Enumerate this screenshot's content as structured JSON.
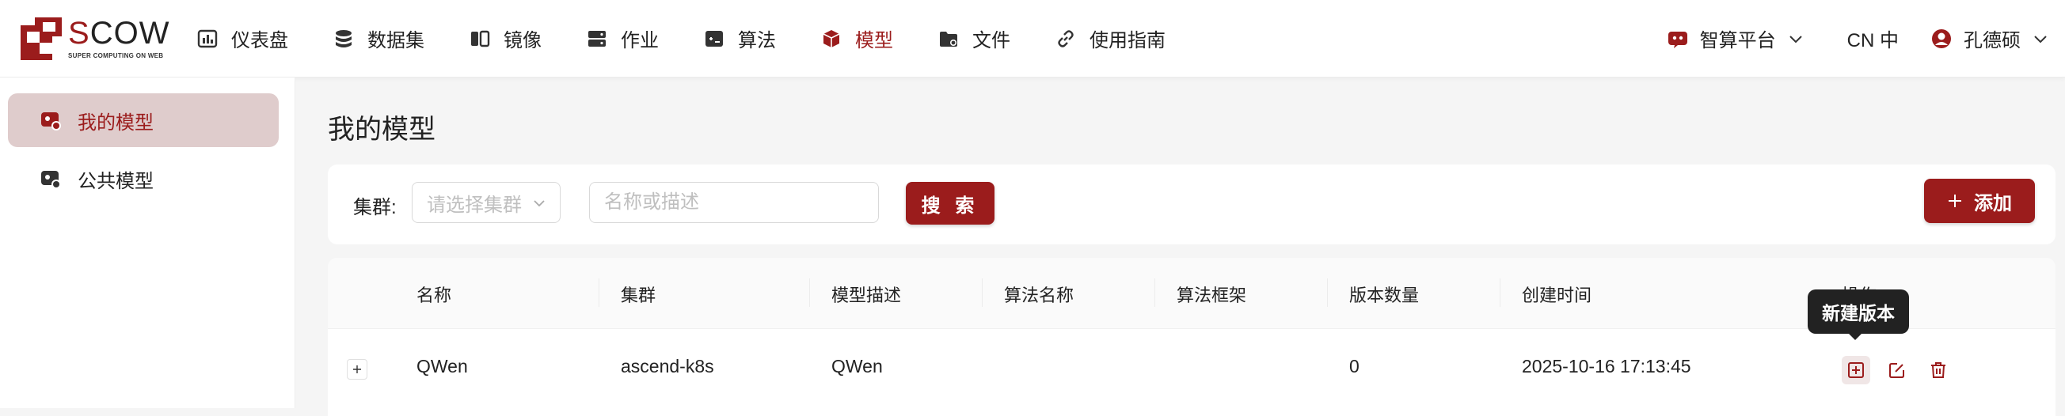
{
  "brand": {
    "name_first_letter": "S",
    "name_rest": "COW",
    "tagline": "SUPER COMPUTING ON WEB",
    "accent_color": "#9b1c1c"
  },
  "nav": {
    "items": [
      {
        "label": "仪表盘",
        "icon": "dashboard-icon"
      },
      {
        "label": "数据集",
        "icon": "database-icon"
      },
      {
        "label": "镜像",
        "icon": "image-icon"
      },
      {
        "label": "作业",
        "icon": "job-icon"
      },
      {
        "label": "算法",
        "icon": "algorithm-icon"
      },
      {
        "label": "模型",
        "icon": "cube-icon",
        "active": true
      },
      {
        "label": "文件",
        "icon": "folder-icon"
      },
      {
        "label": "使用指南",
        "icon": "link-icon"
      }
    ],
    "platform_label": "智算平台",
    "language_label": "CN 中",
    "user_name": "孔德硕"
  },
  "sidebar": {
    "items": [
      {
        "label": "我的模型",
        "active": true
      },
      {
        "label": "公共模型",
        "active": false
      }
    ]
  },
  "page": {
    "title": "我的模型"
  },
  "filter": {
    "cluster_label": "集群:",
    "cluster_placeholder": "请选择集群",
    "search_placeholder": "名称或描述",
    "search_value": "",
    "search_button": "搜 索",
    "add_button": "添加"
  },
  "table": {
    "columns": [
      "名称",
      "集群",
      "模型描述",
      "算法名称",
      "算法框架",
      "版本数量",
      "创建时间",
      "操作"
    ],
    "rows": [
      {
        "name": "QWen",
        "cluster": "ascend-k8s",
        "description": "QWen",
        "algorithm_name": "",
        "algorithm_framework": "",
        "version_count": "0",
        "created_at": "2025-10-16 17:13:45"
      }
    ]
  },
  "tooltip": {
    "text": "新建版本"
  }
}
